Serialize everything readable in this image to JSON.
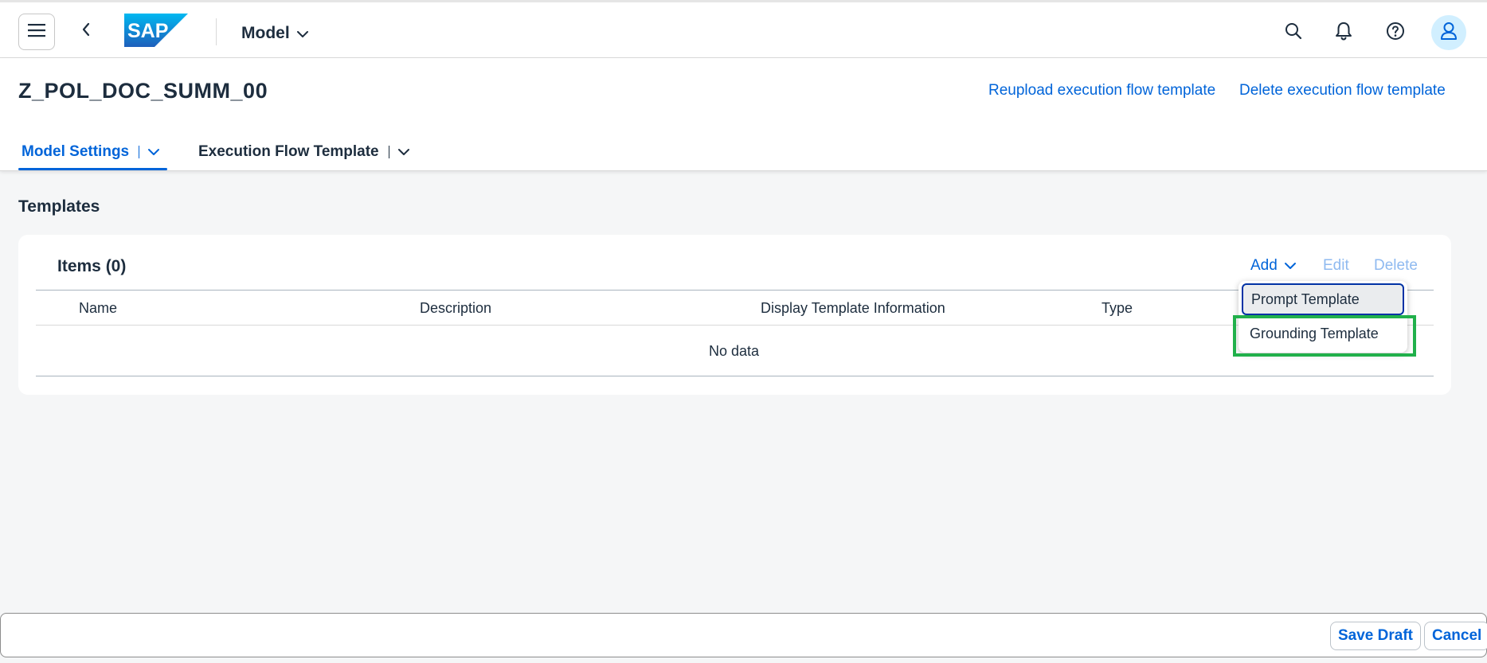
{
  "shell": {
    "logo_text": "SAP",
    "app_menu_label": "Model",
    "icons": [
      "menu-icon",
      "back-icon",
      "search-icon",
      "bell-icon",
      "help-icon",
      "user-icon"
    ]
  },
  "header": {
    "object_title": "Z_POL_DOC_SUMM_00",
    "actions": {
      "reupload": "Reupload execution flow template",
      "delete": "Delete execution flow template"
    },
    "tabs": [
      {
        "label": "Model Settings",
        "active": true
      },
      {
        "label": "Execution Flow Template",
        "active": false
      }
    ]
  },
  "section": {
    "title": "Templates",
    "table": {
      "title": "Items (0)",
      "toolbar": {
        "add": "Add",
        "edit": "Edit",
        "delete": "Delete"
      },
      "columns": [
        "Name",
        "Description",
        "Display Template Information",
        "Type"
      ],
      "empty_text": "No data"
    }
  },
  "add_menu": {
    "items": [
      {
        "label": "Prompt Template",
        "focused": true
      },
      {
        "label": "Grounding Template",
        "focused": false,
        "highlighted": true
      }
    ]
  },
  "footer": {
    "save_draft": "Save Draft",
    "cancel": "Cancel"
  },
  "colors": {
    "accent": "#0064d9",
    "highlight": "#21b04b",
    "background": "#f5f6f7"
  }
}
